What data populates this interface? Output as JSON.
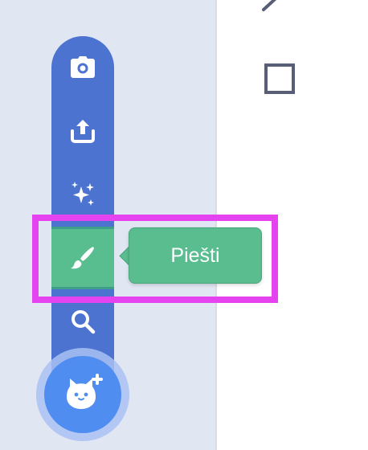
{
  "sprite_menu": {
    "items": [
      {
        "icon": "camera-icon"
      },
      {
        "icon": "upload-icon"
      },
      {
        "icon": "surprise-sparkles-icon"
      },
      {
        "icon": "paint-brush-icon",
        "active": true
      },
      {
        "icon": "search-icon"
      }
    ],
    "tooltip": "Piešti",
    "main_button_icon": "cat-plus-icon"
  },
  "paint_tools": [
    {
      "icon": "line-tool-icon"
    },
    {
      "icon": "rectangle-tool-icon"
    }
  ],
  "colors": {
    "menu_blue": "#4d73d1",
    "active_green": "#59be8f",
    "highlight_magenta": "#e542f0",
    "fab_blue": "#4f8df0",
    "sidebar_bg": "#e0e6f2"
  }
}
